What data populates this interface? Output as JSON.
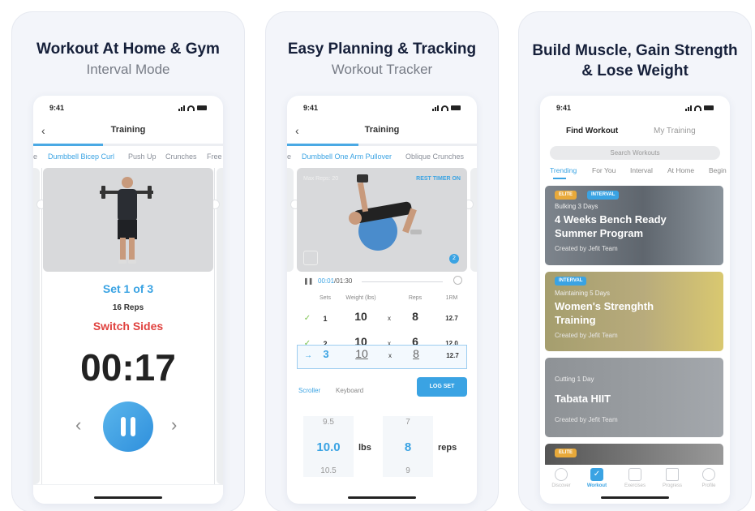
{
  "panels": [
    {
      "headline": "Workout At Home & Gym",
      "subline": "Interval Mode",
      "status_time": "9:41",
      "nav_title": "Training",
      "exercise_tabs": [
        "e",
        "Dumbbell Bicep Curl",
        "Push Up",
        "Crunches",
        "Free"
      ],
      "active_tab": "Dumbbell Bicep Curl",
      "set_label": "Set 1 of 3",
      "reps_label": "16 Reps",
      "switch_label": "Switch Sides",
      "timer": "00:17",
      "icons": {
        "back": "‹",
        "prev": "‹",
        "next": "›"
      }
    },
    {
      "headline": "Easy Planning & Tracking",
      "subline": "Workout Tracker",
      "status_time": "9:41",
      "nav_title": "Training",
      "exercise_tabs": [
        "e",
        "Dumbbell One Arm Pullover",
        "Oblique Crunches"
      ],
      "active_tab": "Dumbbell One Arm Pullover",
      "max_reps": "Max Reps: 20",
      "rest_timer": "REST TIMER ON",
      "badge": "2",
      "time_current": "00:01",
      "time_total": "/01:30",
      "log_headers": [
        "Sets",
        "Weight (lbs)",
        "Reps",
        "1RM"
      ],
      "log_rows": [
        {
          "status": "✓",
          "set": "1",
          "weight": "10",
          "x": "x",
          "reps": "8",
          "orm": "12.7"
        },
        {
          "status": "✓",
          "set": "2",
          "weight": "10",
          "x": "x",
          "reps": "6",
          "orm": "12.0"
        },
        {
          "status": "→",
          "set": "3",
          "weight": "10",
          "x": "x",
          "reps": "8",
          "orm": "12.7"
        }
      ],
      "input_modes": [
        "Scroller",
        "Keyboard"
      ],
      "log_set_label": "LOG SET",
      "picker": {
        "weight_prev": "9.5",
        "weight_sel": "10.0",
        "weight_next": "10.5",
        "weight_unit": "lbs",
        "reps_prev": "7",
        "reps_sel": "8",
        "reps_next": "9",
        "reps_unit": "reps"
      }
    },
    {
      "headline_line1": "Build Muscle, Gain Strength",
      "headline_line2": "& Lose Weight",
      "status_time": "9:41",
      "segments": [
        "Find Workout",
        "My Training"
      ],
      "search_placeholder": "Search Workouts",
      "categories": [
        "Trending",
        "For You",
        "Interval",
        "At Home",
        "Begin"
      ],
      "cards": [
        {
          "tags": [
            "ELITE",
            "INTERVAL"
          ],
          "meta": "Bulking   3 Days",
          "title": "4 Weeks Bench Ready Summer Program",
          "by": "Created by Jefit Team"
        },
        {
          "tags": [
            "INTERVAL"
          ],
          "meta": "Maintaining   5 Days",
          "title": "Women's Strenghth Training",
          "by": "Created by Jefit Team"
        },
        {
          "tags": [],
          "meta": "Cutting   1 Day",
          "title": "Tabata HIIT",
          "by": "Created by Jefit Team"
        },
        {
          "tags": [
            "ELITE"
          ]
        }
      ],
      "tabbar": [
        "Discover",
        "Workout",
        "Exercises",
        "Progress",
        "Profile"
      ],
      "active_tabbar": "Workout"
    }
  ],
  "colors": {
    "accent": "#3aa3e3",
    "alert": "#e0423f",
    "check": "#7cc34e",
    "elite": "#e8a93a",
    "headline": "#16203a"
  }
}
